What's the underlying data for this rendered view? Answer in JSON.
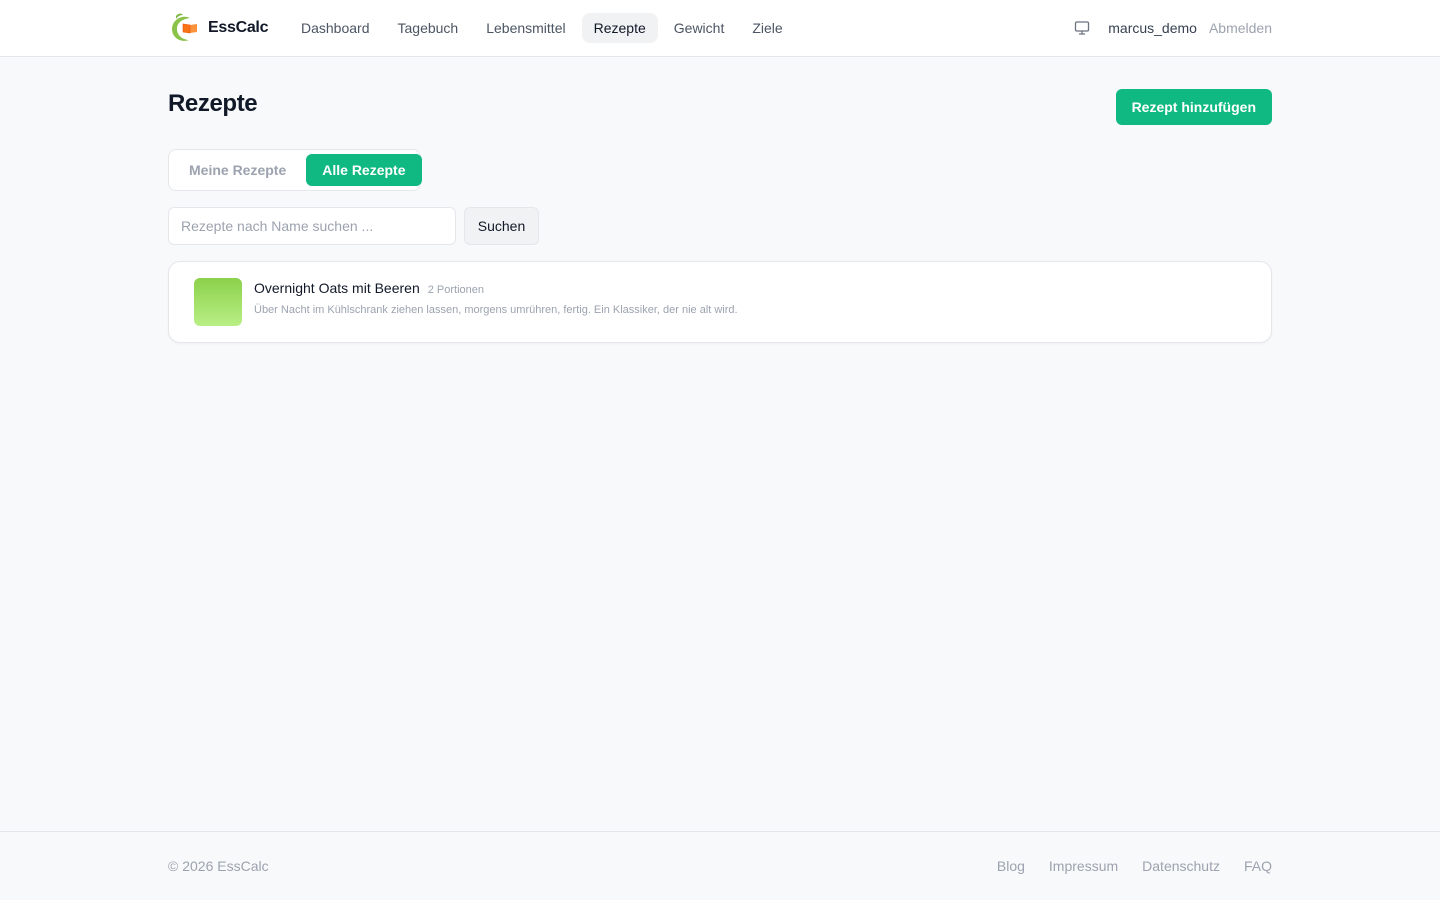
{
  "brand": {
    "name": "EssCalc",
    "logo_icon": "essCalc-logo-icon",
    "colors": {
      "leaf": "#8bc34a",
      "book": "#f97316"
    }
  },
  "nav": {
    "items": [
      {
        "label": "Dashboard",
        "active": false
      },
      {
        "label": "Tagebuch",
        "active": false
      },
      {
        "label": "Lebensmittel",
        "active": false
      },
      {
        "label": "Rezepte",
        "active": true
      },
      {
        "label": "Gewicht",
        "active": false
      },
      {
        "label": "Ziele",
        "active": false
      }
    ]
  },
  "user": {
    "display_icon": "monitor-icon",
    "username": "marcus_demo",
    "logout_label": "Abmelden"
  },
  "page": {
    "title": "Rezepte",
    "add_button_label": "Rezept hinzufügen",
    "accent_color": "#10b981"
  },
  "filter": {
    "tabs": [
      {
        "label": "Meine Rezepte",
        "active": false
      },
      {
        "label": "Alle Rezepte",
        "active": true
      }
    ]
  },
  "search": {
    "placeholder": "Rezepte nach Name suchen ...",
    "value": "",
    "button_label": "Suchen"
  },
  "recipes": [
    {
      "name": "Overnight Oats mit Beeren",
      "portions": "2 Portionen",
      "description": "Über Nacht im Kühlschrank ziehen lassen, morgens umrühren, fertig. Ein Klassiker, der nie alt wird."
    }
  ],
  "footer": {
    "copyright": "© 2026 EssCalc",
    "links": [
      "Blog",
      "Impressum",
      "Datenschutz",
      "FAQ"
    ]
  }
}
